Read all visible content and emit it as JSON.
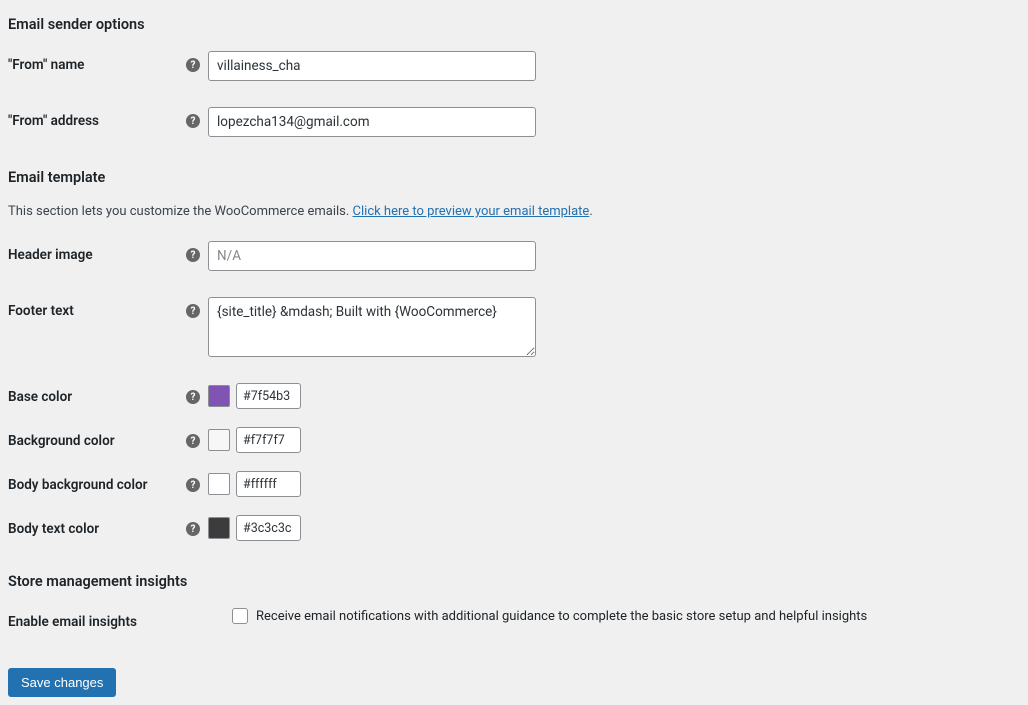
{
  "sender": {
    "heading": "Email sender options",
    "from_name_label": "\"From\" name",
    "from_name_value": "villainess_cha",
    "from_address_label": "\"From\" address",
    "from_address_value": "lopezcha134@gmail.com"
  },
  "template": {
    "heading": "Email template",
    "desc_prefix": "This section lets you customize the WooCommerce emails. ",
    "desc_link": "Click here to preview your email template",
    "desc_suffix": ".",
    "header_image_label": "Header image",
    "header_image_placeholder": "N/A",
    "header_image_value": "",
    "footer_text_label": "Footer text",
    "footer_text_value": "{site_title} &mdash; Built with {WooCommerce}",
    "base_color_label": "Base color",
    "base_color_value": "#7f54b3",
    "background_color_label": "Background color",
    "background_color_value": "#f7f7f7",
    "body_bg_color_label": "Body background color",
    "body_bg_color_value": "#ffffff",
    "body_text_color_label": "Body text color",
    "body_text_color_value": "#3c3c3c"
  },
  "insights": {
    "heading": "Store management insights",
    "enable_label": "Enable email insights",
    "enable_desc": "Receive email notifications with additional guidance to complete the basic store setup and helpful insights"
  },
  "save_button": "Save changes"
}
